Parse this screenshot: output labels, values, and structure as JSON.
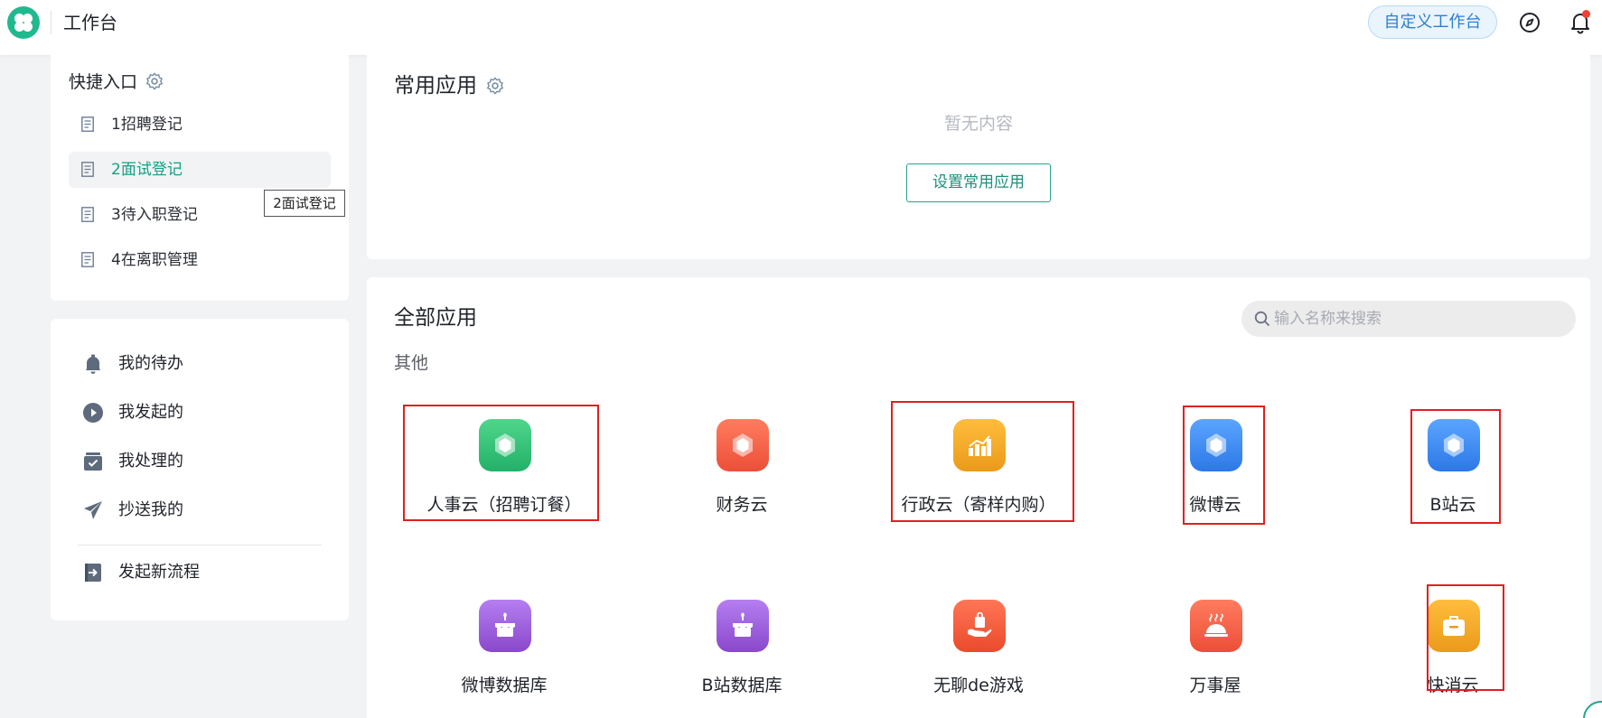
{
  "header": {
    "title": "工作台",
    "customize_button": "自定义工作台",
    "icons": [
      "logo-icon",
      "compass-icon",
      "bell-icon"
    ],
    "notification_dot_color": "#f04134"
  },
  "quick_access": {
    "title": "快捷入口",
    "items": [
      {
        "label": "1招聘登记"
      },
      {
        "label": "2面试登记"
      },
      {
        "label": "3待入职登记"
      },
      {
        "label": "4在离职管理"
      }
    ],
    "tooltip": "2面试登记"
  },
  "workflow": {
    "items": [
      {
        "label": "我的待办",
        "icon": "bell-icon"
      },
      {
        "label": "我发起的",
        "icon": "play-circle-icon"
      },
      {
        "label": "我处理的",
        "icon": "inbox-check-icon"
      },
      {
        "label": "抄送我的",
        "icon": "paper-plane-icon"
      }
    ],
    "start_new": {
      "label": "发起新流程",
      "icon": "export-icon"
    }
  },
  "common_apps": {
    "title": "常用应用",
    "empty_text": "暂无内容",
    "set_button": "设置常用应用"
  },
  "all_apps": {
    "title": "全部应用",
    "search_placeholder": "输入名称来搜索",
    "group": "其他",
    "apps": [
      {
        "name": "人事云（招聘订餐）",
        "icon": "hexagon-icon",
        "color": "#35c277"
      },
      {
        "name": "财务云",
        "icon": "hexagon-icon",
        "color": "#f0634b"
      },
      {
        "name": "行政云（寄样内购）",
        "icon": "bar-chart-icon",
        "color": "#f0a82c"
      },
      {
        "name": "微博云",
        "icon": "hexagon-icon",
        "color": "#3a8cf0"
      },
      {
        "name": "B站云",
        "icon": "hexagon-icon",
        "color": "#3a8cf0"
      },
      {
        "name": "微博数据库",
        "icon": "cake-icon",
        "color": "#9a5ed8"
      },
      {
        "name": "B站数据库",
        "icon": "cake-icon",
        "color": "#9a5ed8"
      },
      {
        "name": "无聊de游戏",
        "icon": "hand-bag-icon",
        "color": "#f05b3c"
      },
      {
        "name": "万事屋",
        "icon": "food-cover-icon",
        "color": "#f0634b"
      },
      {
        "name": "快消云",
        "icon": "briefcase-icon",
        "color": "#f0a82c"
      }
    ],
    "highlight_color": "#e0201f"
  }
}
